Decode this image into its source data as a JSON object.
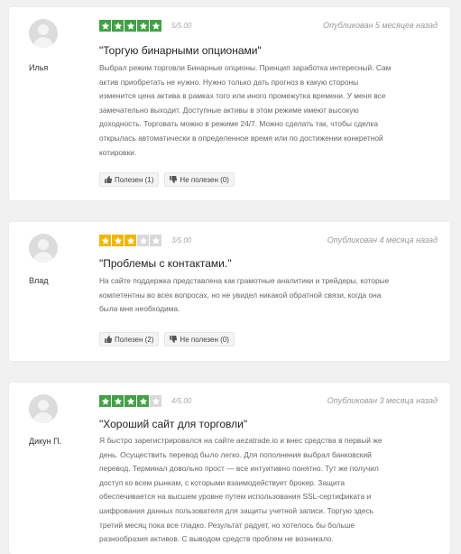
{
  "reviews": [
    {
      "author": "Илья",
      "rating": 5,
      "score": "5/5.00",
      "date": "Опубликован 5 месяцев назад",
      "title": "\"Торгую бинарными опционами\"",
      "lines": [
        "Выбрал режим торговли Бинарные опционы. Принцип заработка интересный. Сам",
        "актив приобретать не нужно. Нужно только дать прогноз в какую стороны",
        "изменится цена актива в рамках того или иного промежутка времени. У меня все",
        "замечательно выходит. Доступные активы в этом режиме имеют высокую",
        "доходность. Торговать можно в режиме 24/7. Можно сделать так, чтобы сделка",
        "открылась автоматически в определенное время или по достижении конкретной",
        "котировки."
      ],
      "helpful_label": "Полезен (1)",
      "not_helpful_label": "Не полезен (0)",
      "star_color": "#43a047"
    },
    {
      "author": "Влад",
      "rating": 3,
      "score": "3/5.00",
      "date": "Опубликован 4 месяца назад",
      "title": "\"Проблемы с контактами.\"",
      "lines": [
        "На сайте поддержка представлена как грамотные аналитики и трейдеры, которые",
        "компетентны во всех вопросах, но не увидел никакой обратной связи, когда она",
        "была мне необходима."
      ],
      "helpful_label": "Полезен (2)",
      "not_helpful_label": "Не полезен (0)",
      "star_color": "#f2b600"
    },
    {
      "author": "Дикун П.",
      "rating": 4,
      "score": "4/5.00",
      "date": "Опубликован 3 месяца назад",
      "title": "\"Хороший сайт для торговли\"",
      "lines": [
        "Я быстро зарегистрировался на сайте aezatrade.io и внес средства в первый же",
        "день. Осуществить перевод было легко. Для пополнения выбрал банковский",
        "перевод. Терминал довольно прост — все интуитивно понятно. Тут же получил",
        "доступ ко всем рынкам, с которыми взаимодействует брокер. Защита",
        "обеспечивается на высшем уровне путем использования SSL-сертификата и",
        "шифрования данных пользователя для защиты учетной записи. Торгую здесь",
        "третий месяц пока все гладко. Результат радует, но хотелось бы больше",
        "разнообразия активов. С выводом средств проблем не возникало."
      ],
      "star_color": "#43a047"
    }
  ],
  "empty_star_color": "#d9d9d9",
  "icons": [
    "thumbs-up-icon",
    "thumbs-down-icon",
    "star-icon",
    "avatar-icon"
  ]
}
